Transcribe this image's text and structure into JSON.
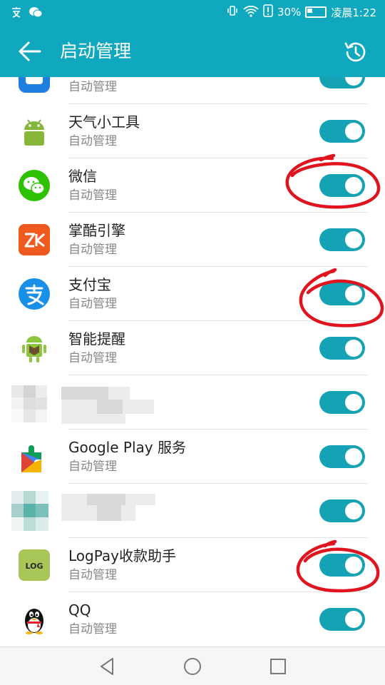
{
  "status_bar": {
    "battery_percent": "30%",
    "time": "凌晨1:22"
  },
  "titlebar": {
    "title": "启动管理"
  },
  "apps": [
    {
      "name": "",
      "subtitle": "自动管理",
      "icon": "partial-app-icon",
      "enabled": true
    },
    {
      "name": "天气小工具",
      "subtitle": "自动管理",
      "icon": "android-icon",
      "enabled": true
    },
    {
      "name": "微信",
      "subtitle": "自动管理",
      "icon": "wechat-icon",
      "enabled": true
    },
    {
      "name": "掌酷引擎",
      "subtitle": "自动管理",
      "icon": "zk-icon",
      "enabled": true
    },
    {
      "name": "支付宝",
      "subtitle": "自动管理",
      "icon": "alipay-icon",
      "enabled": true
    },
    {
      "name": "智能提醒",
      "subtitle": "自动管理",
      "icon": "android-box-icon",
      "enabled": true
    },
    {
      "name": "",
      "subtitle": "",
      "icon": "pixelated-icon",
      "enabled": true
    },
    {
      "name": "Google Play 服务",
      "subtitle": "自动管理",
      "icon": "google-play-services-icon",
      "enabled": true
    },
    {
      "name": "",
      "subtitle": "",
      "icon": "pixelated-icon",
      "enabled": true
    },
    {
      "name": "LogPay收款助手",
      "subtitle": "自动管理",
      "icon": "logpay-icon",
      "enabled": true
    },
    {
      "name": "QQ",
      "subtitle": "自动管理",
      "icon": "qq-penguin-icon",
      "enabled": true
    }
  ],
  "logpay_icon_text": "LOG",
  "colors": {
    "header": "#0fa8bf",
    "toggle_on": "#14a2b4",
    "annotation": "#e0141e"
  }
}
